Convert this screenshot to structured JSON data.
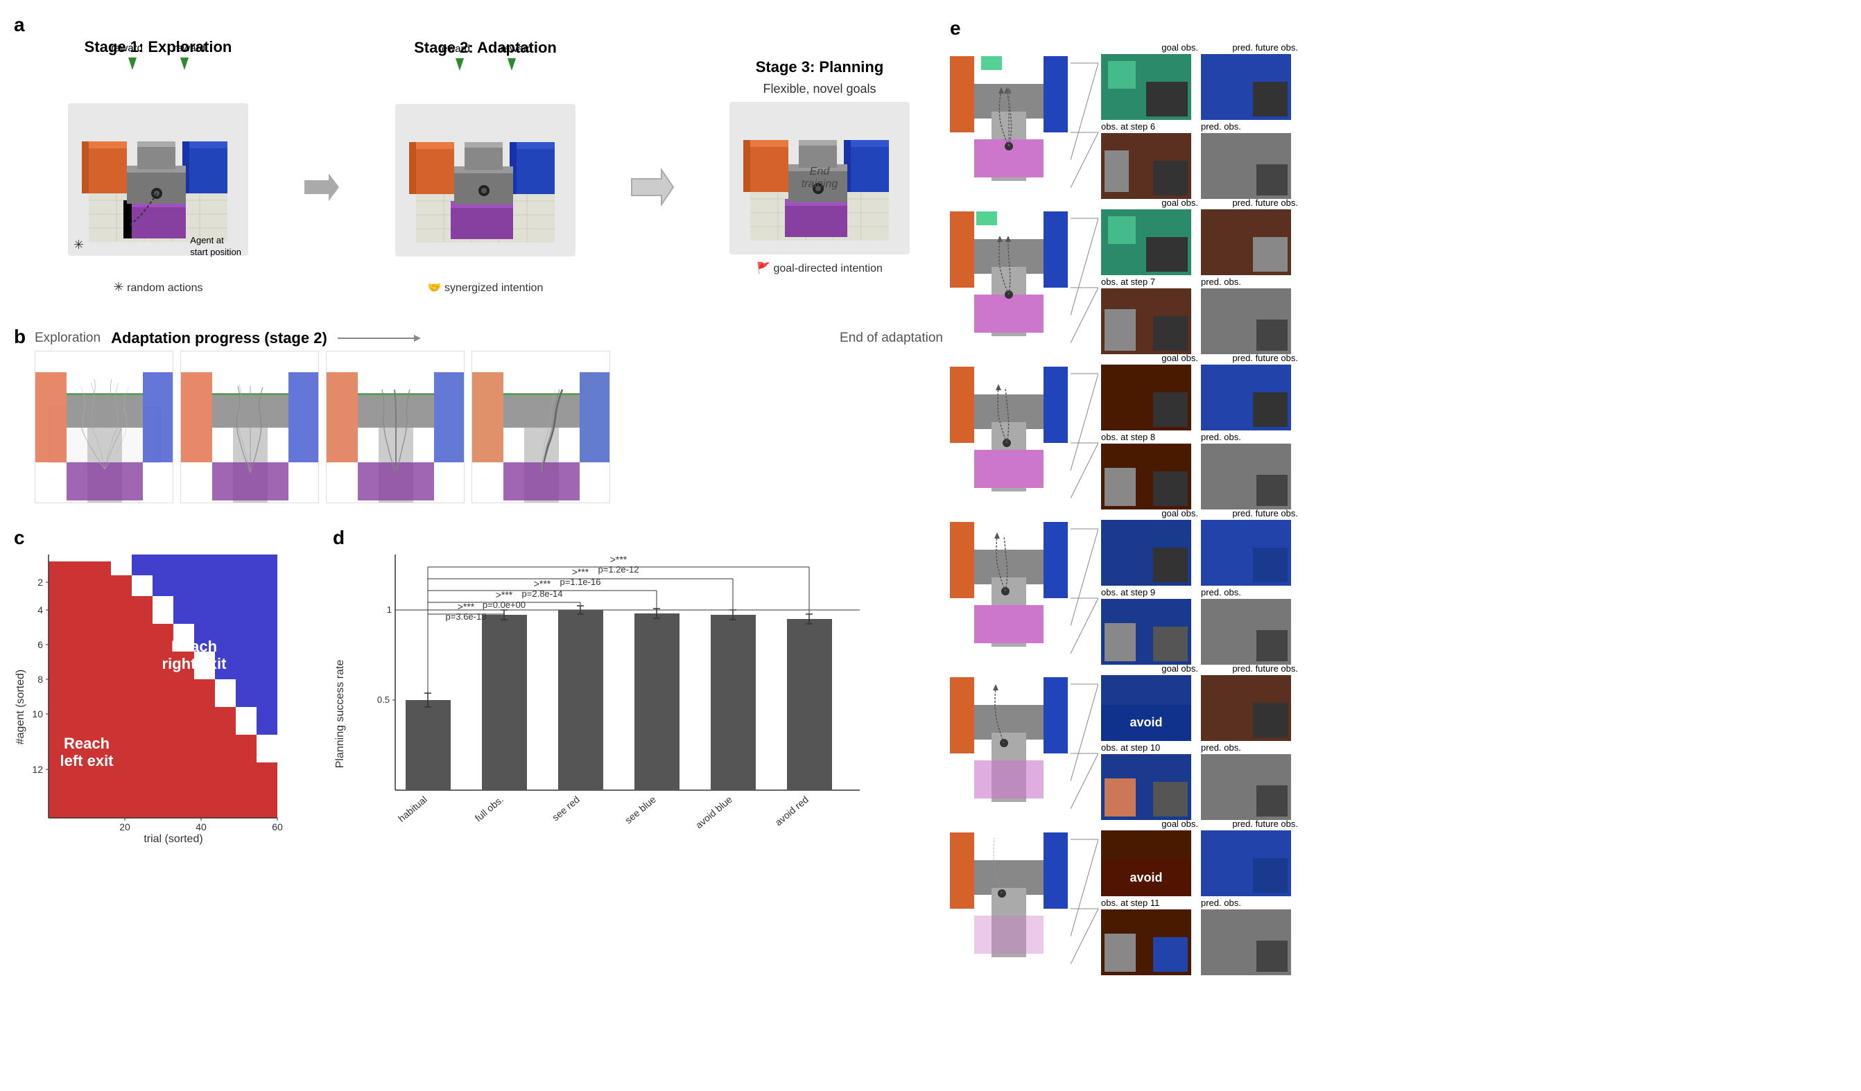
{
  "sections": {
    "a": {
      "label": "a",
      "stages": [
        {
          "title": "Stage 1: Exploration",
          "reward_labels": [
            "reward",
            "reward"
          ],
          "caption": "random actions",
          "caption_icon": "asterisk"
        },
        {
          "title": "Stage 2: Adaptation",
          "reward_labels": [
            "reward",
            "reward"
          ],
          "caption": "synergized intention",
          "caption_icon": "handshake"
        },
        {
          "title": "Stage 3: Planning",
          "subtitle": "Flexible, novel goals",
          "end_training": "End\ntraining",
          "caption": "goal-directed intention",
          "caption_icon": "flag"
        }
      ],
      "agent_label": "Agent at\nstart position"
    },
    "b": {
      "label": "b",
      "progress_label": "Exploration",
      "progress_title": "Adaptation progress (stage 2)",
      "end_label": "End of adaptation",
      "stages": [
        "stage1",
        "stage2",
        "stage3",
        "stage4"
      ]
    },
    "c": {
      "label": "c",
      "y_label": "#agent (sorted)",
      "x_label": "trial (sorted)",
      "x_ticks": [
        "20",
        "40",
        "60"
      ],
      "y_ticks": [
        "2",
        "4",
        "6",
        "8",
        "10",
        "12"
      ],
      "legend": [
        {
          "label": "Reach right exit",
          "color": "#4040cc"
        },
        {
          "label": "Reach left exit",
          "color": "#cc3333"
        }
      ]
    },
    "d": {
      "label": "d",
      "y_label": "Planning success rate",
      "bars": [
        {
          "label": "habitual",
          "value": 0.5,
          "color": "#555"
        },
        {
          "label": "full obs.",
          "value": 0.97,
          "color": "#555"
        },
        {
          "label": "see red",
          "value": 1.0,
          "color": "#555"
        },
        {
          "label": "see blue",
          "value": 0.98,
          "color": "#555"
        },
        {
          "label": "avoid blue",
          "value": 0.97,
          "color": "#555"
        },
        {
          "label": "avoid red",
          "value": 0.95,
          "color": "#555"
        }
      ],
      "reference_line": 1.0,
      "stats": [
        {
          "label": ">***",
          "p_value": "p=1.2e-12"
        },
        {
          "label": ">***",
          "p_value": "p=1.1e-16"
        },
        {
          "label": ">***",
          "p_value": "p=2.8e-14"
        },
        {
          "label": ">***",
          "p_value": "p=0.0e+00"
        },
        {
          "label": ">***",
          "p_value": "p=3.6e-13"
        }
      ]
    },
    "e": {
      "label": "e",
      "steps": [
        {
          "step_num": 6,
          "obs_label": "obs. at step 6",
          "goal_label": "goal obs.",
          "pred_future_label": "pred. future obs.",
          "pred_label": "pred. obs.",
          "goal_color": "green-teal",
          "obs_color": "brown",
          "pred_future_color": "blue",
          "pred_color": "gray"
        },
        {
          "step_num": 7,
          "obs_label": "obs. at step 7",
          "goal_label": "goal obs.",
          "pred_future_label": "pred. future obs.",
          "pred_label": "pred. obs.",
          "goal_color": "green-teal",
          "obs_color": "brown",
          "pred_future_color": "brown",
          "pred_color": "gray"
        },
        {
          "step_num": 8,
          "obs_label": "obs. at step 8",
          "goal_label": "goal obs.",
          "pred_future_label": "pred. future obs.",
          "pred_label": "pred. obs.",
          "goal_color": "brown-dark",
          "obs_color": "brown-dark",
          "pred_future_color": "blue",
          "pred_color": "gray"
        },
        {
          "step_num": 9,
          "obs_label": "obs. at step 9",
          "goal_label": "goal obs.",
          "pred_future_label": "pred. future obs.",
          "pred_label": "pred. obs.",
          "goal_color": "blue-dark",
          "obs_color": "blue-dark",
          "pred_future_color": "blue",
          "pred_color": "gray"
        },
        {
          "step_num": 10,
          "obs_label": "obs. at step 10",
          "goal_label": "goal obs.",
          "pred_future_label": "pred. future obs.",
          "pred_label": "pred. obs.",
          "goal_color": "blue-avoid",
          "obs_color": "blue-avoid",
          "avoid_label": "avoid",
          "pred_future_color": "brown",
          "pred_color": "gray"
        },
        {
          "step_num": 11,
          "obs_label": "obs. at step 11",
          "goal_label": "goal obs.",
          "pred_future_label": "pred. future obs.",
          "pred_label": "pred. obs.",
          "goal_color": "brown-avoid",
          "obs_color": "brown-avoid",
          "avoid_label": "avoid",
          "pred_future_color": "blue",
          "pred_color": "gray"
        }
      ]
    }
  }
}
